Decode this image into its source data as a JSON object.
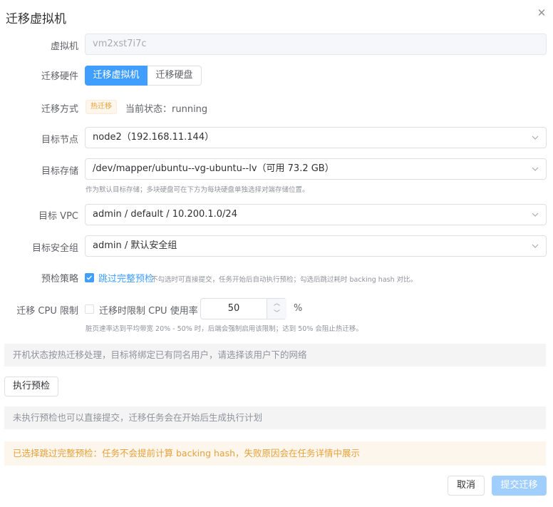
{
  "dialog": {
    "title": "迁移虚拟机",
    "close_icon": "close-icon"
  },
  "vm": {
    "label": "虚拟机",
    "value": "vm2xst7i7c"
  },
  "migrate_hardware": {
    "label": "迁移硬件",
    "options": [
      "迁移虚拟机",
      "迁移硬盘"
    ],
    "selected": "迁移虚拟机"
  },
  "migrate_mode": {
    "label": "迁移方式",
    "tag": "热迁移",
    "status": "当前状态：running"
  },
  "target_node": {
    "label": "目标节点",
    "value": "node2（192.168.11.144）"
  },
  "target_storage": {
    "label": "目标存储",
    "value": "/dev/mapper/ubuntu--vg-ubuntu--lv（可用 73.2 GB）",
    "hint": "作为默认目标存储；多块硬盘可在下方为每块硬盘单独选择对端存储位置。"
  },
  "target_vpc": {
    "label": "目标 VPC",
    "value": "admin / default / 10.200.1.0/24"
  },
  "target_sg": {
    "label": "目标安全组",
    "value": "admin / 默认安全组"
  },
  "precheck": {
    "label": "预检策略",
    "checked": true,
    "option": "跳过完整预检",
    "desc": "不勾选时可直接提交，任务开始后自动执行预检；勾选后跳过耗时 backing hash 对比。"
  },
  "cpu_limit": {
    "label": "迁移 CPU 限制",
    "checked": false,
    "option": "迁移时限制 CPU 使用率",
    "value": "50",
    "unit": "%",
    "hint": "脏页速率达到平均带宽 20% - 50% 时，后端会强制启用该限制；达到 50% 会阻止热迁移。"
  },
  "info_network": "开机状态按热迁移处理，目标将绑定已有同名用户，请选择该用户下的网络",
  "precheck_button": "执行预检",
  "info_precheck": "未执行预检也可以直接提交，迁移任务会在开始后生成执行计划",
  "warning": "已选择跳过完整预检：任务不会提前计算 backing hash，失败原因会在任务详情中展示",
  "footer": {
    "cancel": "取消",
    "confirm": "提交迁移"
  },
  "colors": {
    "primary": "#409eff",
    "primary_light": "#a0cfff",
    "warning": "#e6a23c",
    "warning_bg": "#fdf6ec"
  }
}
